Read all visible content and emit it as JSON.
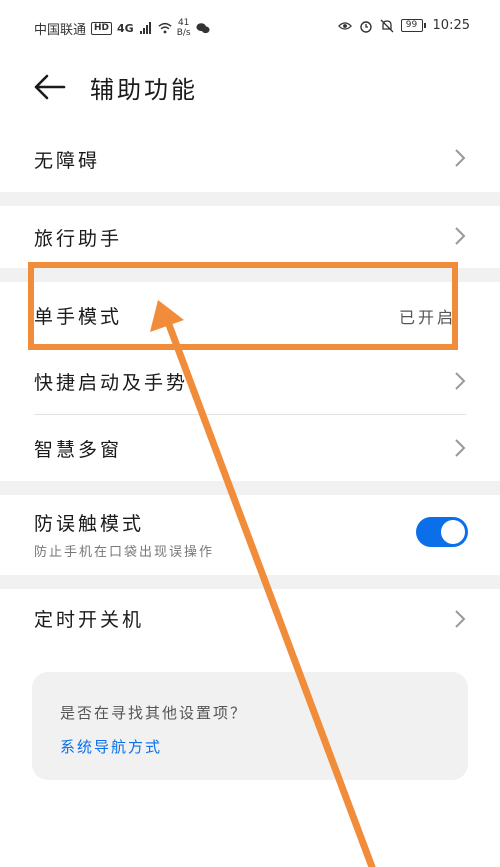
{
  "statusbar": {
    "carrier": "中国联通",
    "hd": "HD",
    "network": "4G",
    "speed_value": "41",
    "speed_unit": "B/s",
    "battery": "99",
    "time": "10:25"
  },
  "header": {
    "title": "辅助功能"
  },
  "rows": [
    {
      "label": "无障碍"
    },
    {
      "label": "旅行助手"
    },
    {
      "label": "单手模式",
      "value": "已开启"
    },
    {
      "label": "快捷启动及手势"
    },
    {
      "label": "智慧多窗"
    },
    {
      "label": "防误触模式",
      "sub": "防止手机在口袋出现误操作",
      "toggle_on": true
    },
    {
      "label": "定时开关机"
    }
  ],
  "card": {
    "question": "是否在寻找其他设置项？",
    "link": "系统导航方式"
  },
  "colors": {
    "accent": "#0a6fe8",
    "annotation": "#f08c3a",
    "section_gap": "#f1f1f1"
  }
}
